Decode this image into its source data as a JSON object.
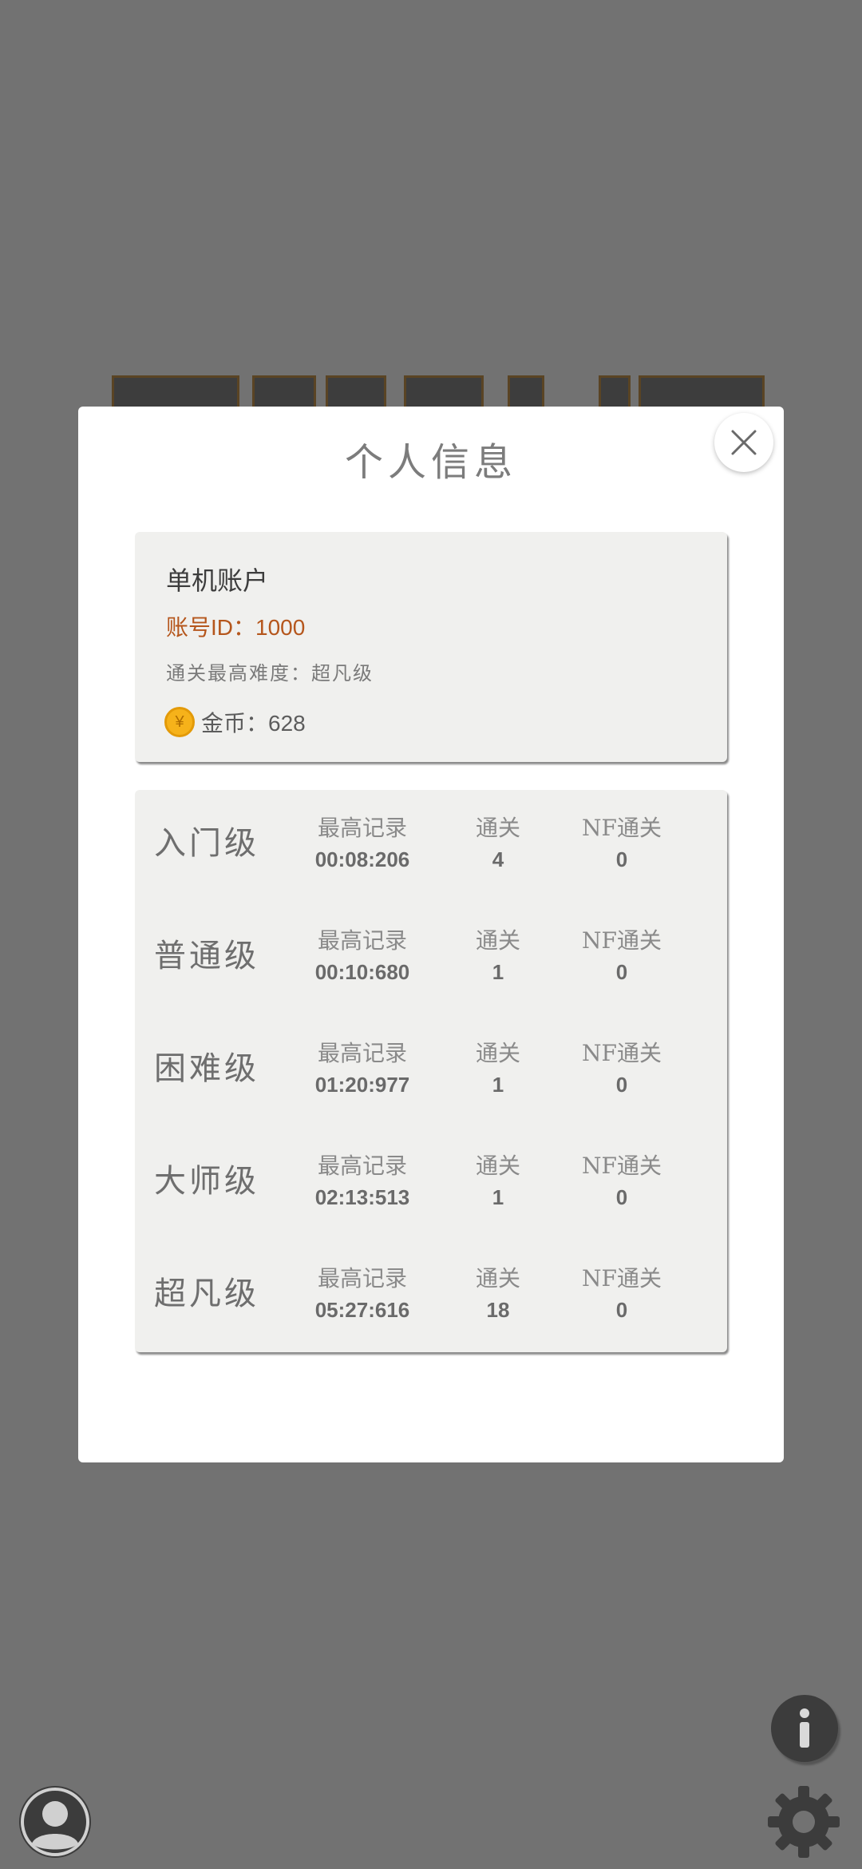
{
  "modal": {
    "title": "个人信息",
    "close_icon": "close-icon"
  },
  "account": {
    "name": "单机账户",
    "id_text": "账号ID：1000",
    "best_difficulty_text": "通关最高难度：超凡级",
    "coins_text": "金币：628",
    "coin_symbol": "¥",
    "coin_color": "#f6b21a",
    "id_color": "#b5561c"
  },
  "records": {
    "rows": [
      {
        "level": "入门级",
        "best_label": "最高记录",
        "best_value": "00:08:206",
        "clear_label": "通关",
        "clear_value": "4",
        "nf_label": "NF通关",
        "nf_value": "0"
      },
      {
        "level": "普通级",
        "best_label": "最高记录",
        "best_value": "00:10:680",
        "clear_label": "通关",
        "clear_value": "1",
        "nf_label": "NF通关",
        "nf_value": "0"
      },
      {
        "level": "困难级",
        "best_label": "最高记录",
        "best_value": "01:20:977",
        "clear_label": "通关",
        "clear_value": "1",
        "nf_label": "NF通关",
        "nf_value": "0"
      },
      {
        "level": "大师级",
        "best_label": "最高记录",
        "best_value": "02:13:513",
        "clear_label": "通关",
        "clear_value": "1",
        "nf_label": "NF通关",
        "nf_value": "0"
      },
      {
        "level": "超凡级",
        "best_label": "最高记录",
        "best_value": "05:27:616",
        "clear_label": "通关",
        "clear_value": "18",
        "nf_label": "NF通关",
        "nf_value": "0"
      }
    ]
  },
  "controls": {
    "info_icon": "info-icon",
    "avatar_icon": "user-avatar-icon",
    "settings_icon": "gear-icon"
  },
  "colors": {
    "backdrop": "#727272",
    "card_bg": "#f0f0ee",
    "control_dark": "#3c3c3c"
  }
}
